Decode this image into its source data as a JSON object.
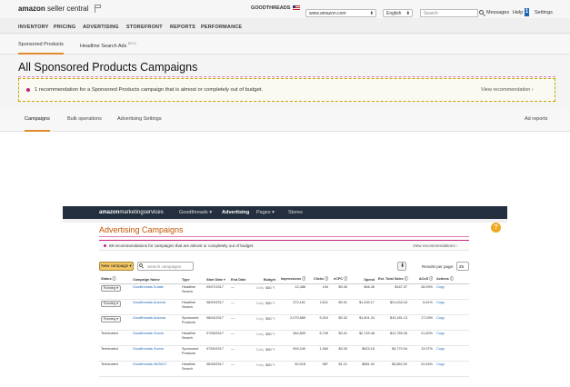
{
  "seller_central": {
    "logo_bold": "amazon",
    "logo_rest": "seller central",
    "store_name": "GOODTHREADS",
    "marketplace": "www.amazon.com",
    "language": "English",
    "search_placeholder": "Search",
    "messages": "Messages",
    "help": "Help",
    "help_badge": "1",
    "settings": "Settings",
    "nav": [
      "INVENTORY",
      "PRICING",
      "ADVERTISING",
      "STOREFRONT",
      "REPORTS",
      "PERFORMANCE"
    ],
    "subnav": {
      "sponsored_products": "Sponsored Products",
      "headline_search_ads": "Headline Search Ads",
      "headline_badge": "BETA"
    },
    "page_title": "All Sponsored Products Campaigns",
    "alert": {
      "text": "1 recommendation for a Sponsored Products campaign that is almost or completely out of budget.",
      "link": "View recommendation ›"
    },
    "tabs": {
      "campaigns": "Campaigns",
      "bulk": "Bulk operations",
      "advertising_settings": "Advertising Settings",
      "reports": "Ad reports"
    }
  },
  "ams": {
    "logo_bold": "amazon",
    "logo_rest": "marketingservices",
    "nav": {
      "account": "Goodthreads ▾",
      "advertising": "Advertising",
      "pages": "Pages ▾",
      "stores": "Stores"
    },
    "help_icon": "?",
    "title": "Advertising Campaigns",
    "alert": {
      "text": "68 recommendations for campaigns that are almost or completely out of budget.",
      "link": "View recommendations ›"
    },
    "new_campaign": "New campaign ▾",
    "search_placeholder": "Search campaigns",
    "download_icon": "⬇",
    "results_label": "Results per page:",
    "results_value": "25",
    "columns": [
      "Status ⓘ",
      "Campaign Name",
      "Type",
      "Start Date ▾",
      "End Date",
      "Budget",
      "Impressions ⓘ",
      "Clicks ⓘ",
      "eCPC ⓘ",
      "Spend",
      "Est. Total Sales ⓘ",
      "ACoS ⓘ",
      "Actions ⓘ"
    ],
    "rows": [
      {
        "status": "Running ▾",
        "name": "Goodthreads 5-date",
        "type": "Headline Search",
        "start": "09/07/2017",
        "end": "—",
        "budget_tag": "Daily",
        "budget": "$30",
        "impressions": "12,486",
        "clicks": "194",
        "ecpc": "$0.30",
        "spend": "$46.45",
        "sales": "$167.37",
        "acos": "28.93%",
        "action": "Copy"
      },
      {
        "status": "Running ▾",
        "name": "Goodthreads Automa",
        "type": "Headline Search",
        "start": "08/09/2017",
        "end": "—",
        "budget_tag": "Daily",
        "budget": "$30",
        "impressions": "373,161",
        "clicks": "2,811",
        "ecpc": "$0.51",
        "spend": "$1,430.17",
        "sales": "$21,634.18",
        "acos": "6.61%",
        "action": "Copy"
      },
      {
        "status": "Running ▾",
        "name": "Goodthreads Automa",
        "type": "Sponsored Products",
        "start": "08/04/2017",
        "end": "—",
        "budget_tag": "Daily",
        "budget": "$30",
        "impressions": "2,079,889",
        "clicks": "5,310",
        "ecpc": "$0.32",
        "spend": "$1,601.24",
        "sales": "$10,181.13",
        "acos": "17.03%",
        "action": "Copy"
      },
      {
        "status": "Terminated",
        "name": "Goodthreads Summ",
        "type": "Headline Search",
        "start": "07/08/2017",
        "end": "—",
        "budget_tag": "Daily",
        "budget": "$30",
        "impressions": "464,859",
        "clicks": "6,749",
        "ecpc": "$0.41",
        "spend": "$2,749.48",
        "sales": "$12,789.28",
        "acos": "21.50%",
        "action": "Copy"
      },
      {
        "status": "Terminated",
        "name": "Goodthreads Summ",
        "type": "Sponsored Products",
        "start": "07/05/2017",
        "end": "—",
        "budget_tag": "Daily",
        "budget": "$30",
        "impressions": "909,240",
        "clicks": "1,960",
        "ecpc": "$0.33",
        "spend": "$623.18",
        "sales": "$4,770.94",
        "acos": "13.07%",
        "action": "Copy"
      },
      {
        "status": "Terminated",
        "name": "Goodthreads 06/28/17",
        "type": "Headline Search",
        "start": "06/28/2017",
        "end": "—",
        "budget_tag": "Daily",
        "budget": "$30",
        "impressions": "50,018",
        "clicks": "587",
        "ecpc": "$1.21",
        "spend": "$681.42",
        "sales": "$3,862.92",
        "acos": "22.64%",
        "action": "Copy"
      }
    ]
  }
}
